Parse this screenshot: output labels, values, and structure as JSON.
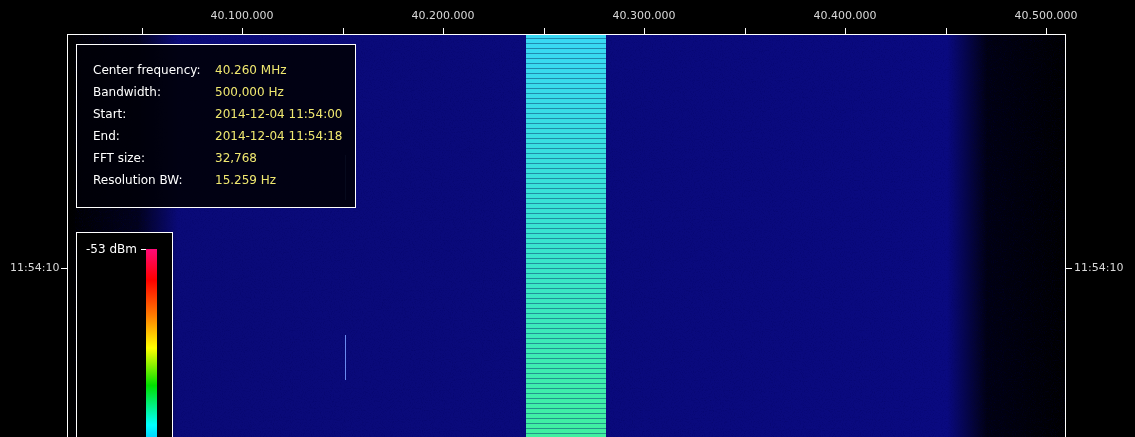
{
  "x_axis": {
    "labels": [
      "40.100.000",
      "40.200.000",
      "40.300.000",
      "40.400.000",
      "40.500.000"
    ]
  },
  "y_axis": {
    "left_label": "11:54:10",
    "right_label": "11:54:10"
  },
  "info": [
    {
      "label": "Center frequency:",
      "value": "40.260 MHz"
    },
    {
      "label": "Bandwidth:",
      "value": "500,000 Hz"
    },
    {
      "label": "Start:",
      "value": "2014-12-04 11:54:00"
    },
    {
      "label": "End:",
      "value": "2014-12-04 11:54:18"
    },
    {
      "label": "FFT size:",
      "value": "32,768"
    },
    {
      "label": "Resolution BW:",
      "value": "15.259 Hz"
    }
  ],
  "colorbar": {
    "max_label": "-53 dBm"
  }
}
